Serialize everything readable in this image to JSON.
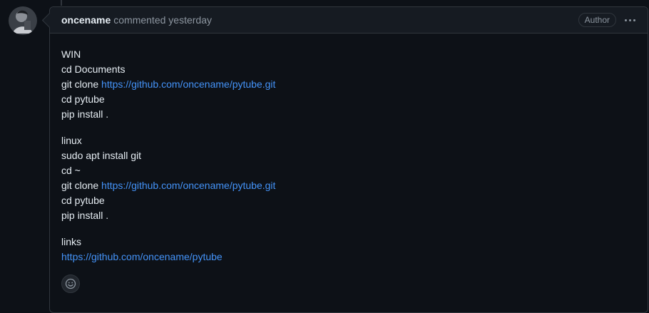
{
  "comment": {
    "author": "oncename",
    "meta": "commented yesterday",
    "badge": "Author",
    "more_icon": "kebab-horizontal-icon",
    "reaction_icon": "smiley-icon",
    "avatar_icon": "user-avatar",
    "body": {
      "win": {
        "title": "WIN",
        "cmd1": "cd Documents",
        "cmd2_prefix": "git clone ",
        "cmd2_link": "https://github.com/oncename/pytube.git",
        "cmd3": "cd pytube",
        "cmd4": "pip install ."
      },
      "linux": {
        "title": "linux",
        "cmd1": "sudo apt install git",
        "cmd2": "cd ~",
        "cmd3_prefix": "git clone ",
        "cmd3_link": "https://github.com/oncename/pytube.git",
        "cmd4": "cd pytube",
        "cmd5": "pip install ."
      },
      "links": {
        "title": "links",
        "url": "https://github.com/oncename/pytube"
      }
    }
  },
  "colors": {
    "background": "#0d1117",
    "header_bg": "#161b22",
    "border": "#30363d",
    "text": "#e6edf3",
    "muted": "#8d96a0",
    "link": "#4493f8"
  }
}
